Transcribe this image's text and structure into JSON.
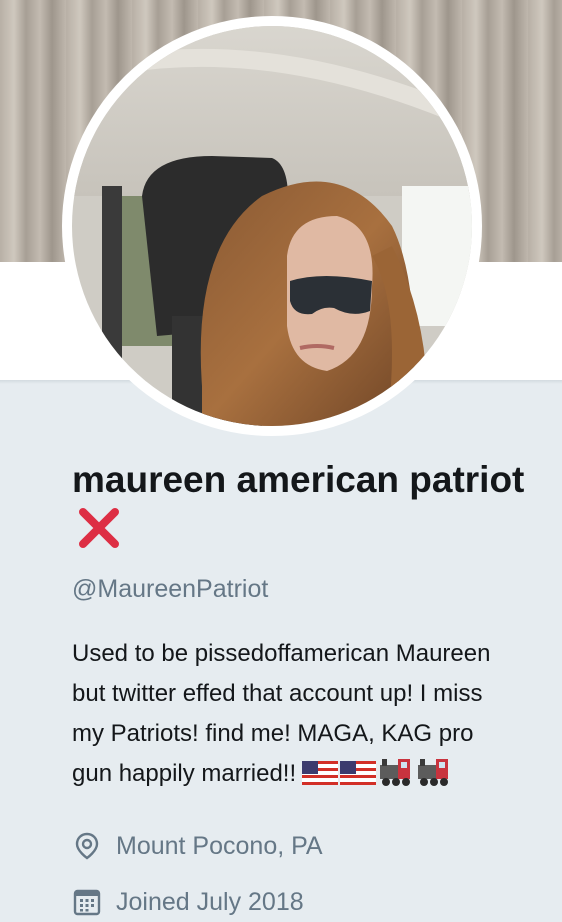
{
  "profile": {
    "name": "maureen american patriot",
    "name_emoji": "cross-mark-icon",
    "handle": "@MaureenPatriot",
    "bio_lines": [
      "Used to be pissedoffamerican Maureen",
      "but twitter effed that account up! I miss",
      "my Patriots! find me! MAGA, KAG pro",
      "gun happily married!!"
    ],
    "bio_emojis": [
      "us-flag-icon",
      "us-flag-icon",
      "locomotive-icon",
      "locomotive-icon"
    ],
    "location": "Mount Pocono, PA",
    "joined": "Joined July 2018"
  },
  "colors": {
    "background": "#e6ecf0",
    "text_primary": "#14171a",
    "text_secondary": "#657786",
    "cross_mark": "#dd2e44"
  }
}
